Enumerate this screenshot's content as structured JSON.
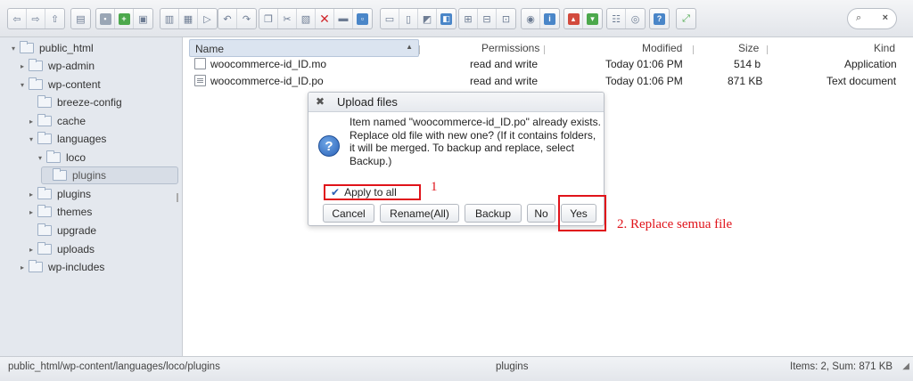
{
  "toolbar": {
    "search_icon": "magnifier-icon",
    "clear_icon": "×"
  },
  "tree": {
    "items": [
      {
        "label": "public_html"
      },
      {
        "label": "wp-admin"
      },
      {
        "label": "wp-content"
      },
      {
        "label": "breeze-config"
      },
      {
        "label": "cache"
      },
      {
        "label": "languages"
      },
      {
        "label": "loco"
      },
      {
        "label": "plugins"
      },
      {
        "label": "plugins"
      },
      {
        "label": "themes"
      },
      {
        "label": "upgrade"
      },
      {
        "label": "uploads"
      },
      {
        "label": "wp-includes"
      }
    ]
  },
  "filelist": {
    "headers": {
      "name": "Name",
      "permissions": "Permissions",
      "modified": "Modified",
      "size": "Size",
      "kind": "Kind"
    },
    "rows": [
      {
        "name": "woocommerce-id_ID.mo",
        "permissions": "read and write",
        "modified": "Today 01:06 PM",
        "size": "514 b",
        "kind": "Application"
      },
      {
        "name": "woocommerce-id_ID.po",
        "permissions": "read and write",
        "modified": "Today 01:06 PM",
        "size": "871 KB",
        "kind": "Text document"
      }
    ]
  },
  "dialog": {
    "close_glyph": "✖",
    "title": "Upload files",
    "icon_glyph": "?",
    "message_line1": "Item named \"woocommerce-id_ID.po\" already exists.",
    "message_line2": "Replace old file with new one? (If it contains folders, it will be merged. To backup and replace, select Backup.)",
    "apply_all_label": "Apply to all",
    "apply_all_checked": true,
    "buttons": {
      "cancel": "Cancel",
      "rename_all": "Rename(All)",
      "backup": "Backup",
      "no": "No",
      "yes": "Yes"
    }
  },
  "annotations": {
    "step1": "1",
    "step2": "2. Replace semua file",
    "color": "#e0131a"
  },
  "statusbar": {
    "path": "public_html/wp-content/languages/loco/plugins",
    "current": "plugins",
    "summary": "Items: 2, Sum: 871 KB"
  }
}
